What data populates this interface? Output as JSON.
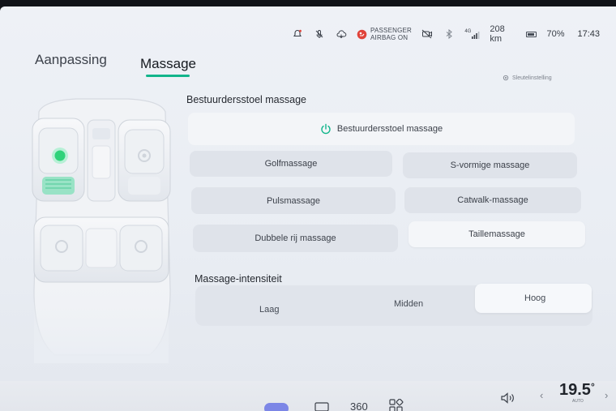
{
  "status": {
    "airbag_line1": "PASSENGER",
    "airbag_line2": "AIRBAG ON",
    "network": "4G",
    "range": "208 km",
    "battery": "70%",
    "time": "17:43"
  },
  "tabs": [
    {
      "label": "Aanpassing"
    },
    {
      "label": "Massage"
    }
  ],
  "shortcut_label": "Sleutelinstelling",
  "driver_section": {
    "title": "Bestuurdersstoel massage",
    "power_label": "Bestuurdersstoel massage",
    "modes": [
      {
        "label": "Golfmassage"
      },
      {
        "label": "S-vormige massage"
      },
      {
        "label": "Pulsmassage"
      },
      {
        "label": "Catwalk-massage"
      },
      {
        "label": "Dubbele rij massage"
      },
      {
        "label": "Taillemassage"
      }
    ]
  },
  "intensity": {
    "title": "Massage-intensiteit",
    "options": [
      {
        "label": "Laag"
      },
      {
        "label": "Midden"
      },
      {
        "label": "Hoog"
      }
    ],
    "selected": "Hoog"
  },
  "dock": {
    "view360": "360",
    "temp": "19.5",
    "temp_unit": "°",
    "auto": "AUTO"
  },
  "colors": {
    "accent": "#12b58b",
    "active_seat": "#2fd27a",
    "airbag_icon": "#e0433a"
  }
}
